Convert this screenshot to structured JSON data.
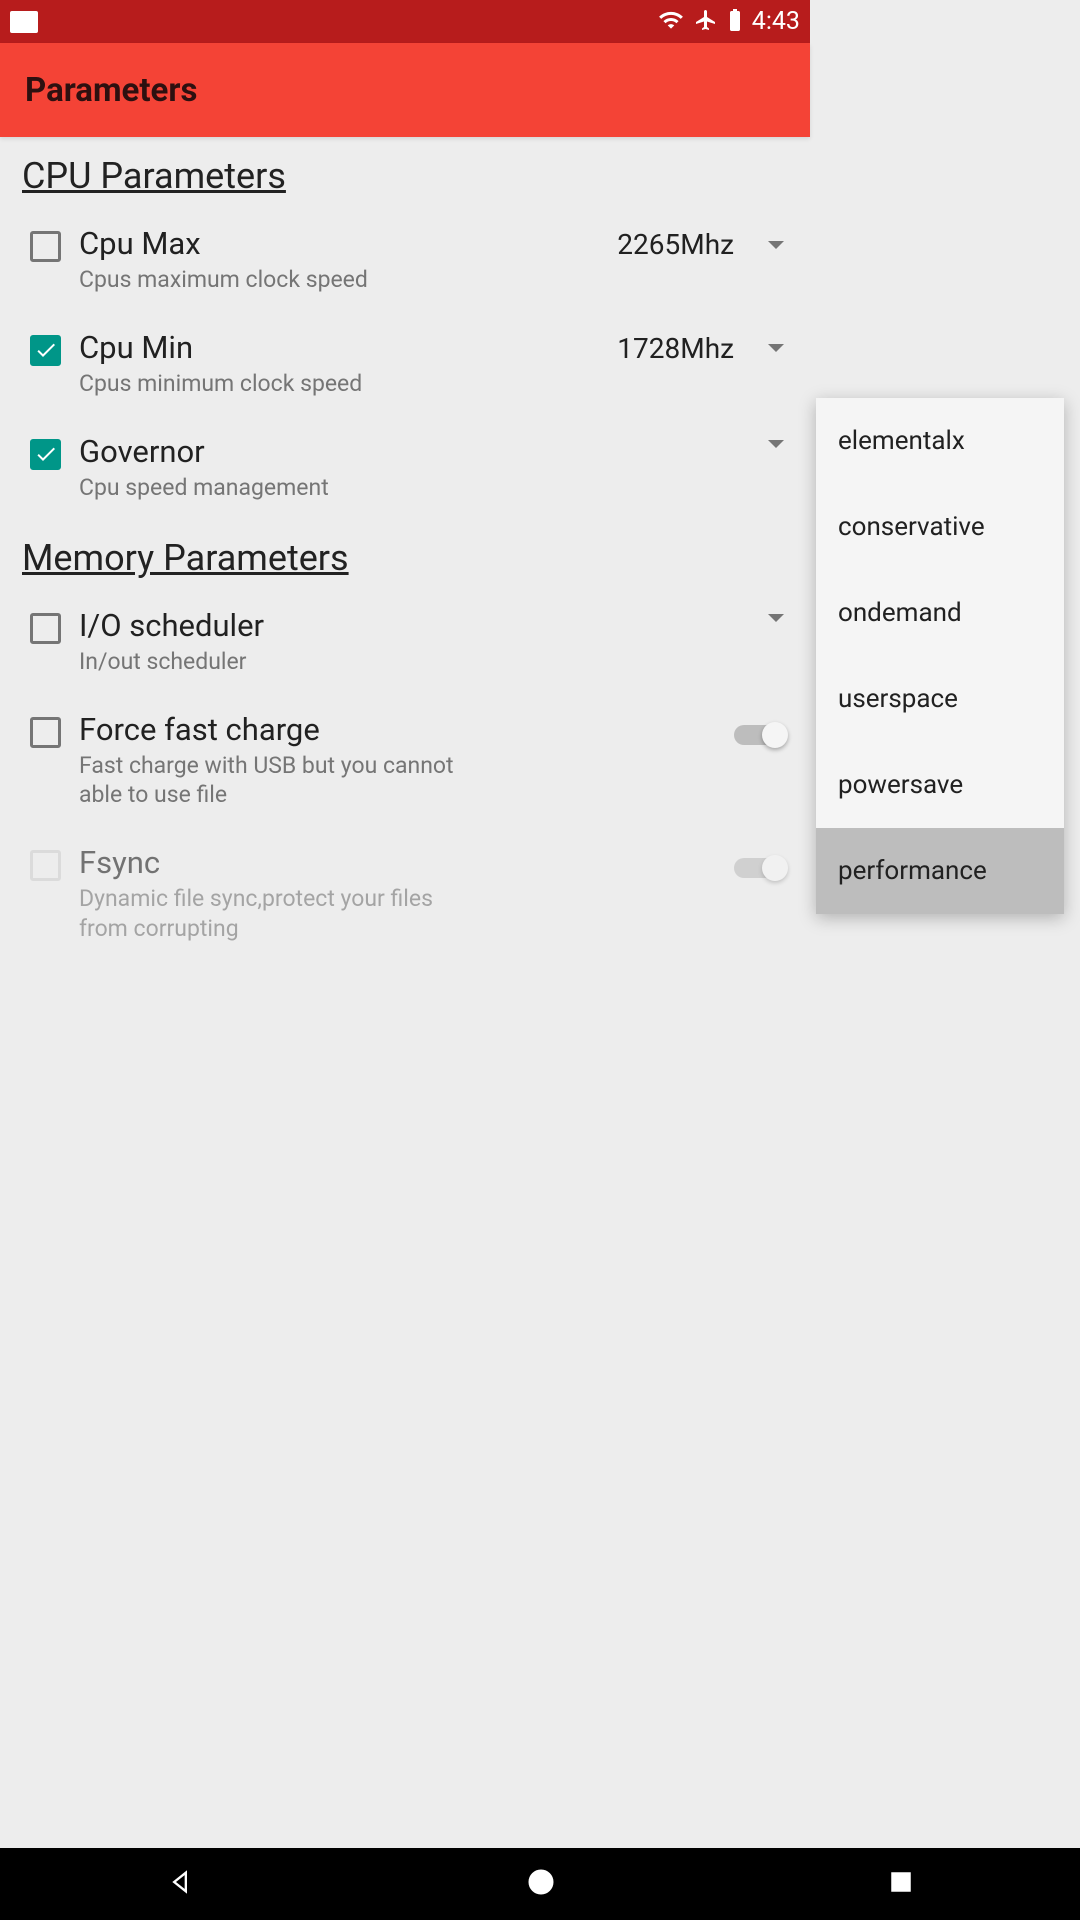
{
  "status_bar": {
    "time": "4:43"
  },
  "app_bar": {
    "title": "Parameters"
  },
  "sections": {
    "cpu": {
      "header": "CPU Parameters",
      "items": [
        {
          "title": "Cpu Max",
          "description": "Cpus maximum clock speed",
          "value": "2265Mhz",
          "checked": false
        },
        {
          "title": "Cpu Min",
          "description": "Cpus minimum clock speed",
          "value": "1728Mhz",
          "checked": true
        },
        {
          "title": "Governor",
          "description": "Cpu speed management",
          "checked": true
        }
      ]
    },
    "memory": {
      "header": "Memory Parameters",
      "items": [
        {
          "title": "I/O scheduler",
          "description": "In/out scheduler",
          "checked": false
        },
        {
          "title": "Force fast charge",
          "description": "Fast charge with USB but you cannot able to use file",
          "checked": false
        },
        {
          "title": "Fsync",
          "description": "Dynamic file sync,protect your files from corrupting",
          "checked": false
        }
      ]
    }
  },
  "dropdown": {
    "options": [
      "elementalx",
      "conservative",
      "ondemand",
      "userspace",
      "powersave",
      "performance"
    ]
  }
}
